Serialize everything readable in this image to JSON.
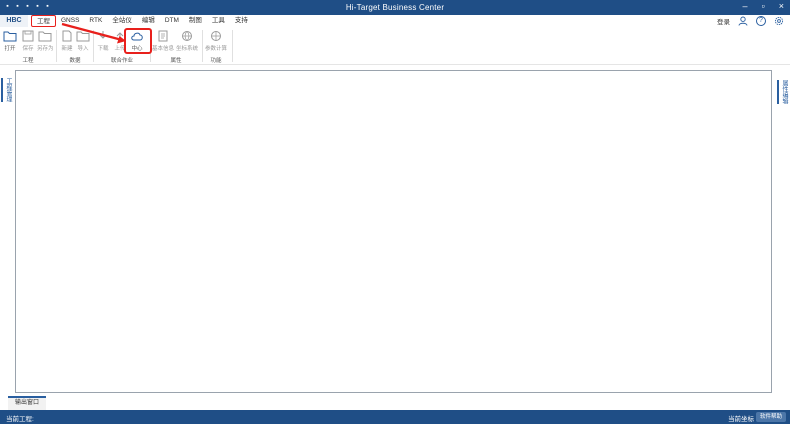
{
  "app": {
    "title": "Hi-Target Business Center",
    "logo": "HBC"
  },
  "menu": {
    "tabs": [
      {
        "label": "工程",
        "active": true
      },
      {
        "label": "GNSS",
        "active": false
      },
      {
        "label": "RTK",
        "active": false
      },
      {
        "label": "全站仪",
        "active": false
      },
      {
        "label": "编辑",
        "active": false
      },
      {
        "label": "DTM",
        "active": false
      },
      {
        "label": "制图",
        "active": false
      },
      {
        "label": "工具",
        "active": false
      },
      {
        "label": "支持",
        "active": false
      }
    ],
    "login": "登录"
  },
  "ribbon": {
    "groups": [
      {
        "label": "工程",
        "buttons": [
          "打开",
          "保存",
          "另存为"
        ]
      },
      {
        "label": "数据",
        "buttons": [
          "新建",
          "导入"
        ]
      },
      {
        "label": "联合作业",
        "buttons": [
          "下载",
          "上传",
          "中心"
        ]
      },
      {
        "label": "属性",
        "buttons": [
          "基本信息",
          "坐标系统"
        ]
      },
      {
        "label": "功能",
        "buttons": [
          "参数计算"
        ]
      }
    ]
  },
  "side": {
    "left_tab": "工程管理",
    "right_tab": "属性编辑"
  },
  "bottom": {
    "tab": "输出窗口"
  },
  "status": {
    "left": "当前工程:",
    "right": "当前坐标",
    "button": "软件帮助"
  },
  "colors": {
    "titlebar": "#1f4e86",
    "highlight": "#e8201c",
    "accent": "#2a5fa0"
  }
}
